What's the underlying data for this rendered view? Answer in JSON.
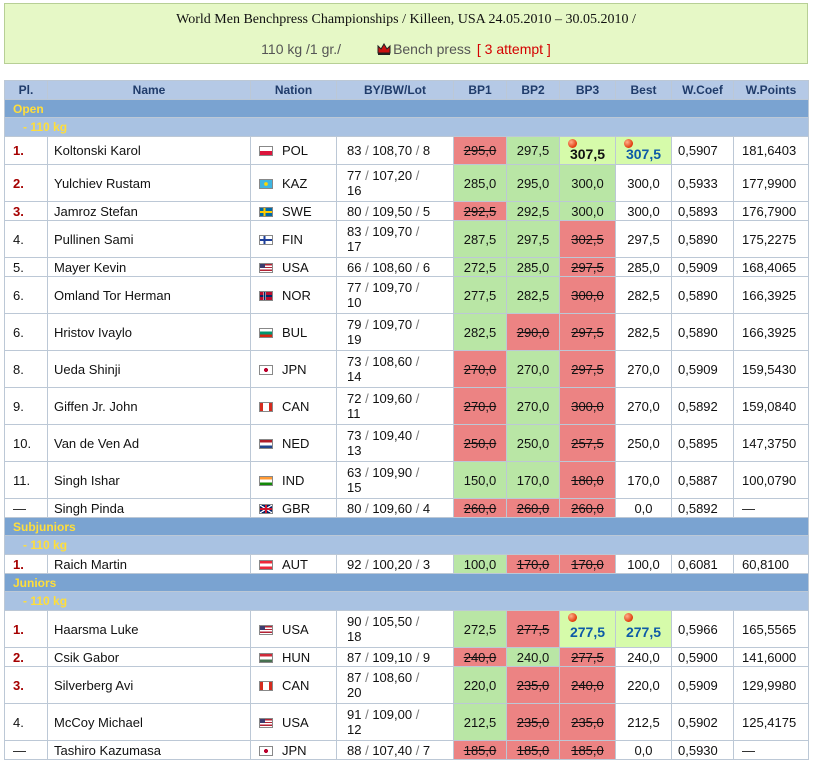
{
  "header": {
    "title": "World Men Benchpress Championships / Killeen, USA 24.05.2010 – 30.05.2010 /",
    "weight_class": "110 kg /1 gr./",
    "discipline": "Bench press",
    "attempt": "[ 3 attempt ]",
    "crown_icon": "crown-icon"
  },
  "columns": [
    "Pl.",
    "Name",
    "Nation",
    "BY/BW/Lot",
    "BP1",
    "BP2",
    "BP3",
    "Best",
    "W.Coef",
    "W.Points"
  ],
  "colors": {
    "header_bg": "#e6f8c6",
    "good": "#b9e6a5",
    "bad": "#ec8383",
    "record": "#d6fbaa",
    "section": "#7aa3d1",
    "section_text": "#ffde3a"
  },
  "sections": [
    {
      "name": "Open",
      "class": "- 110 kg",
      "rows": [
        {
          "pl": "1.",
          "name": "Koltonski Karol",
          "nation": "POL",
          "by": "83",
          "bw": "108,70",
          "lot": "8",
          "bp1": "295,0",
          "bp2": "297,5",
          "bp3": "307,5",
          "best": "307,5",
          "coef": "0,5907",
          "points": "181,6403"
        },
        {
          "pl": "2.",
          "name": "Yulchiev Rustam",
          "nation": "KAZ",
          "by": "77",
          "bw": "107,20",
          "lot": "16",
          "bp1": "285,0",
          "bp2": "295,0",
          "bp3": "300,0",
          "best": "300,0",
          "coef": "0,5933",
          "points": "177,9900"
        },
        {
          "pl": "3.",
          "name": "Jamroz Stefan",
          "nation": "SWE",
          "by": "80",
          "bw": "109,50",
          "lot": "5",
          "bp1": "292,5",
          "bp2": "292,5",
          "bp3": "300,0",
          "best": "300,0",
          "coef": "0,5893",
          "points": "176,7900"
        },
        {
          "pl": "4.",
          "name": "Pullinen Sami",
          "nation": "FIN",
          "by": "83",
          "bw": "109,70",
          "lot": "17",
          "bp1": "287,5",
          "bp2": "297,5",
          "bp3": "302,5",
          "best": "297,5",
          "coef": "0,5890",
          "points": "175,2275"
        },
        {
          "pl": "5.",
          "name": "Mayer Kevin",
          "nation": "USA",
          "by": "66",
          "bw": "108,60",
          "lot": "6",
          "bp1": "272,5",
          "bp2": "285,0",
          "bp3": "297,5",
          "best": "285,0",
          "coef": "0,5909",
          "points": "168,4065"
        },
        {
          "pl": "6.",
          "name": "Omland Tor Herman",
          "nation": "NOR",
          "by": "77",
          "bw": "109,70",
          "lot": "10",
          "bp1": "277,5",
          "bp2": "282,5",
          "bp3": "300,0",
          "best": "282,5",
          "coef": "0,5890",
          "points": "166,3925"
        },
        {
          "pl": "6.",
          "name": "Hristov Ivaylo",
          "nation": "BUL",
          "by": "79",
          "bw": "109,70",
          "lot": "19",
          "bp1": "282,5",
          "bp2": "290,0",
          "bp3": "297,5",
          "best": "282,5",
          "coef": "0,5890",
          "points": "166,3925"
        },
        {
          "pl": "8.",
          "name": "Ueda Shinji",
          "nation": "JPN",
          "by": "73",
          "bw": "108,60",
          "lot": "14",
          "bp1": "270,0",
          "bp2": "270,0",
          "bp3": "297,5",
          "best": "270,0",
          "coef": "0,5909",
          "points": "159,5430"
        },
        {
          "pl": "9.",
          "name": "Giffen Jr. John",
          "nation": "CAN",
          "by": "72",
          "bw": "109,60",
          "lot": "11",
          "bp1": "270,0",
          "bp2": "270,0",
          "bp3": "300,0",
          "best": "270,0",
          "coef": "0,5892",
          "points": "159,0840"
        },
        {
          "pl": "10.",
          "name": "Van de Ven Ad",
          "nation": "NED",
          "by": "73",
          "bw": "109,40",
          "lot": "13",
          "bp1": "250,0",
          "bp2": "250,0",
          "bp3": "257,5",
          "best": "250,0",
          "coef": "0,5895",
          "points": "147,3750"
        },
        {
          "pl": "11.",
          "name": "Singh Ishar",
          "nation": "IND",
          "by": "63",
          "bw": "109,90",
          "lot": "15",
          "bp1": "150,0",
          "bp2": "170,0",
          "bp3": "180,0",
          "best": "170,0",
          "coef": "0,5887",
          "points": "100,0790"
        },
        {
          "pl": "—",
          "name": "Singh Pinda",
          "nation": "GBR",
          "by": "80",
          "bw": "109,60",
          "lot": "4",
          "bp1": "260,0",
          "bp2": "260,0",
          "bp3": "260,0",
          "best": "0,0",
          "coef": "0,5892",
          "points": "—"
        }
      ]
    },
    {
      "name": "Subjuniors",
      "class": "- 110 kg",
      "rows": [
        {
          "pl": "1.",
          "name": "Raich Martin",
          "nation": "AUT",
          "by": "92",
          "bw": "100,20",
          "lot": "3",
          "bp1": "100,0",
          "bp2": "170,0",
          "bp3": "170,0",
          "best": "100,0",
          "coef": "0,6081",
          "points": "60,8100"
        }
      ]
    },
    {
      "name": "Juniors",
      "class": "- 110 kg",
      "rows": [
        {
          "pl": "1.",
          "name": "Haarsma Luke",
          "nation": "USA",
          "by": "90",
          "bw": "105,50",
          "lot": "18",
          "bp1": "272,5",
          "bp2": "277,5",
          "bp3": "277,5",
          "best": "277,5",
          "coef": "0,5966",
          "points": "165,5565"
        },
        {
          "pl": "2.",
          "name": "Csik Gabor",
          "nation": "HUN",
          "by": "87",
          "bw": "109,10",
          "lot": "9",
          "bp1": "240,0",
          "bp2": "240,0",
          "bp3": "277,5",
          "best": "240,0",
          "coef": "0,5900",
          "points": "141,6000"
        },
        {
          "pl": "3.",
          "name": "Silverberg Avi",
          "nation": "CAN",
          "by": "87",
          "bw": "108,60",
          "lot": "20",
          "bp1": "220,0",
          "bp2": "235,0",
          "bp3": "240,0",
          "best": "220,0",
          "coef": "0,5909",
          "points": "129,9980"
        },
        {
          "pl": "4.",
          "name": "McCoy Michael",
          "nation": "USA",
          "by": "91",
          "bw": "109,00",
          "lot": "12",
          "bp1": "212,5",
          "bp2": "235,0",
          "bp3": "235,0",
          "best": "212,5",
          "coef": "0,5902",
          "points": "125,4175"
        },
        {
          "pl": "—",
          "name": "Tashiro Kazumasa",
          "nation": "JPN",
          "by": "88",
          "bw": "107,40",
          "lot": "7",
          "bp1": "185,0",
          "bp2": "185,0",
          "bp3": "185,0",
          "best": "0,0",
          "coef": "0,5930",
          "points": "—"
        }
      ]
    }
  ]
}
